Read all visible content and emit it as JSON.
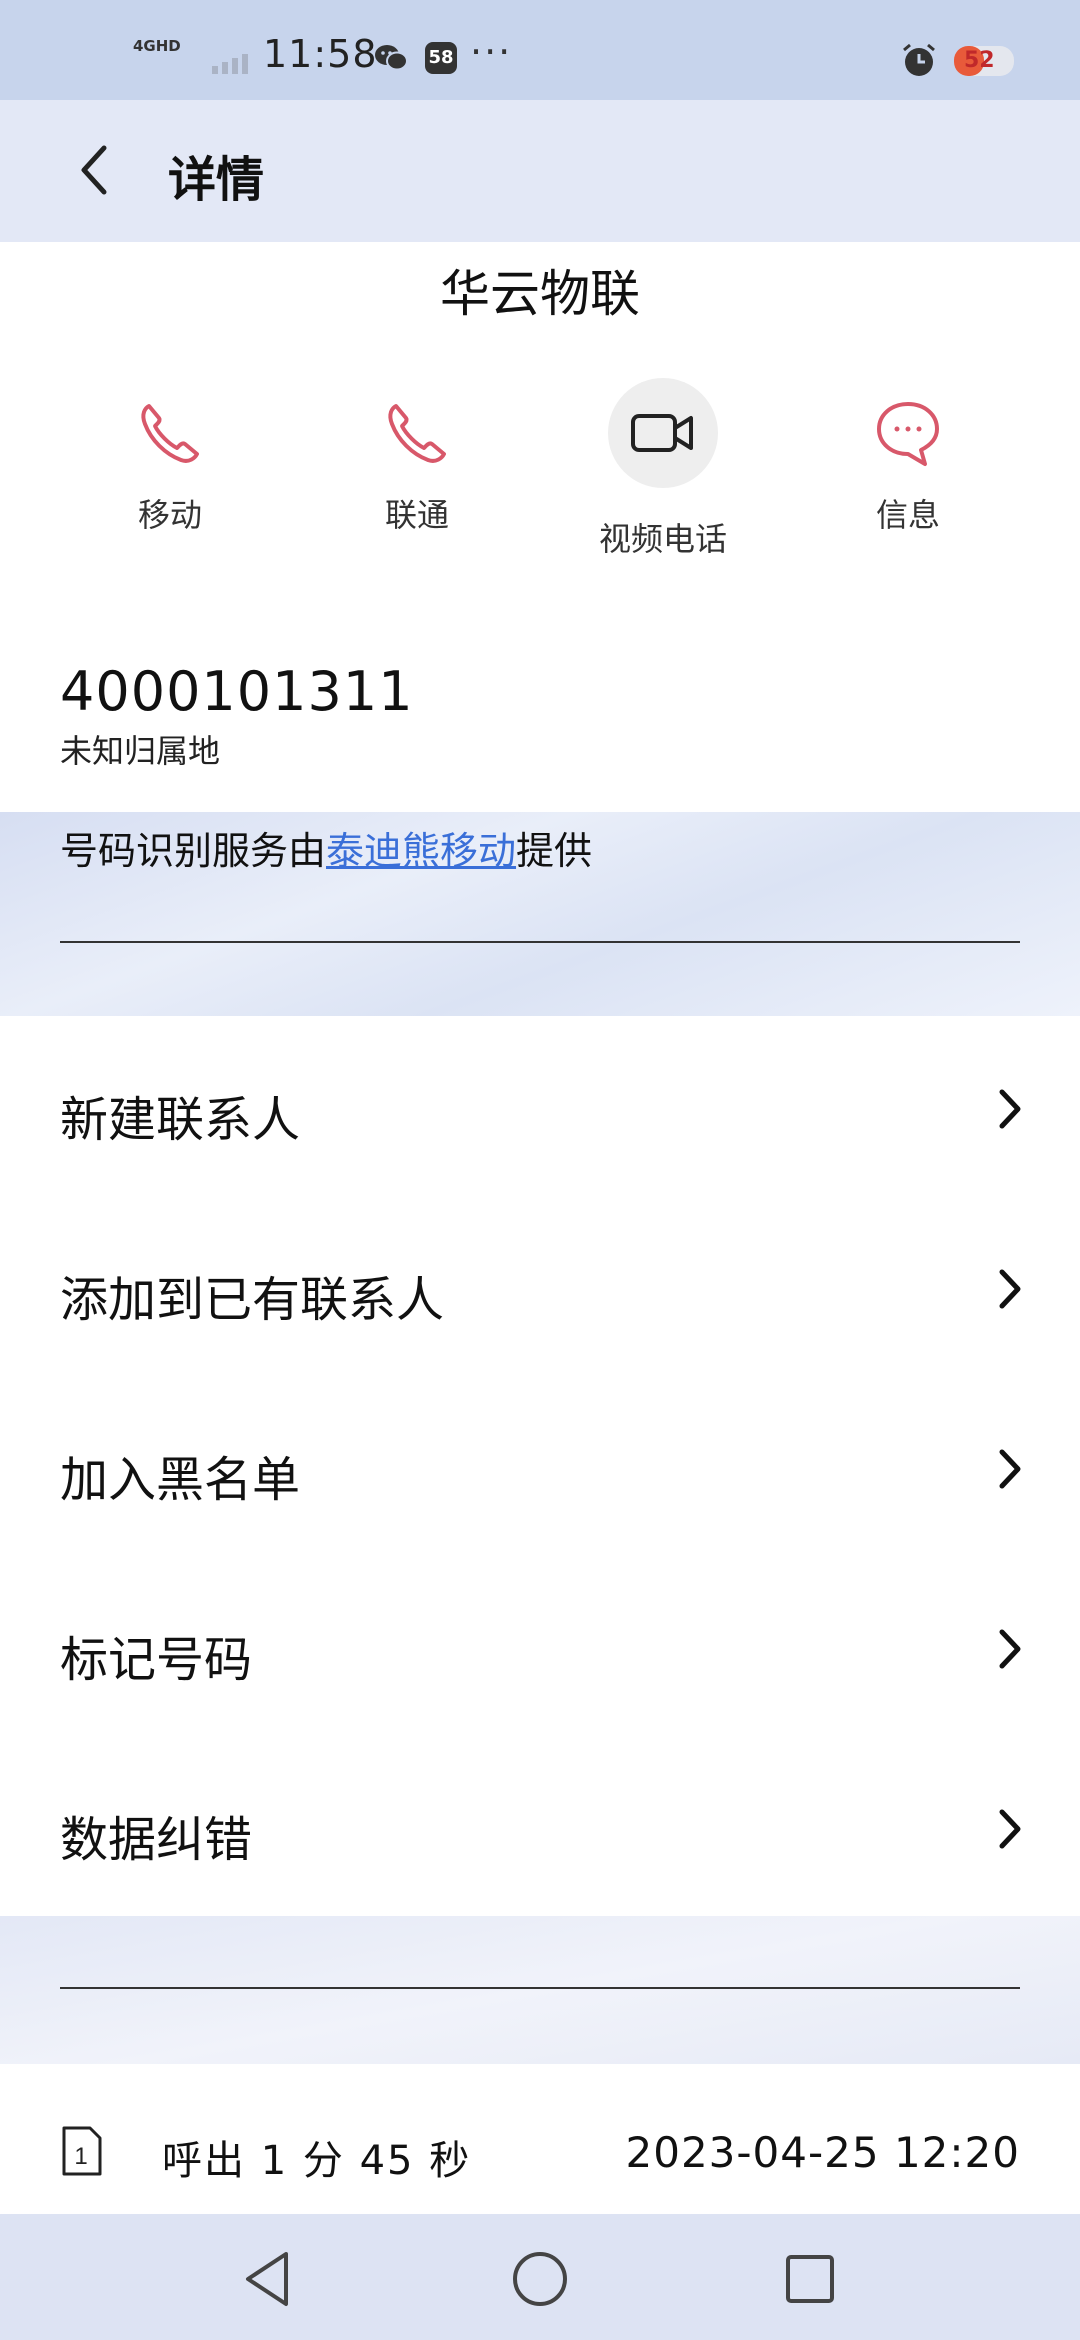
{
  "status_bar": {
    "network": "4GHD",
    "time": "11:58",
    "notification_badge": "58",
    "more": "···",
    "battery": "52",
    "icons": [
      "signal-icon",
      "wechat-icon",
      "alarm-icon",
      "battery-icon"
    ]
  },
  "header": {
    "title": "详情"
  },
  "contact": {
    "name": "华云物联",
    "number": "4000101311",
    "location": "未知归属地"
  },
  "actions": [
    {
      "label": "移动",
      "icon": "phone-icon"
    },
    {
      "label": "联通",
      "icon": "phone-icon"
    },
    {
      "label": "视频电话",
      "icon": "video-icon"
    },
    {
      "label": "信息",
      "icon": "message-icon"
    }
  ],
  "provider": {
    "prefix": "号码识别服务由",
    "link": "泰迪熊移动",
    "suffix": "提供"
  },
  "menu": [
    {
      "label": "新建联系人"
    },
    {
      "label": "添加到已有联系人"
    },
    {
      "label": "加入黑名单"
    },
    {
      "label": "标记号码"
    },
    {
      "label": "数据纠错"
    }
  ],
  "call_record": {
    "sim": "1",
    "description": "呼出 1 分 45 秒",
    "datetime": "2023-04-25 12:20"
  },
  "colors": {
    "accent_link": "#3a6fd8",
    "phone_icon": "#d8586a",
    "header_bg": "#e3e8f6",
    "status_bg": "#c7d4ec"
  }
}
